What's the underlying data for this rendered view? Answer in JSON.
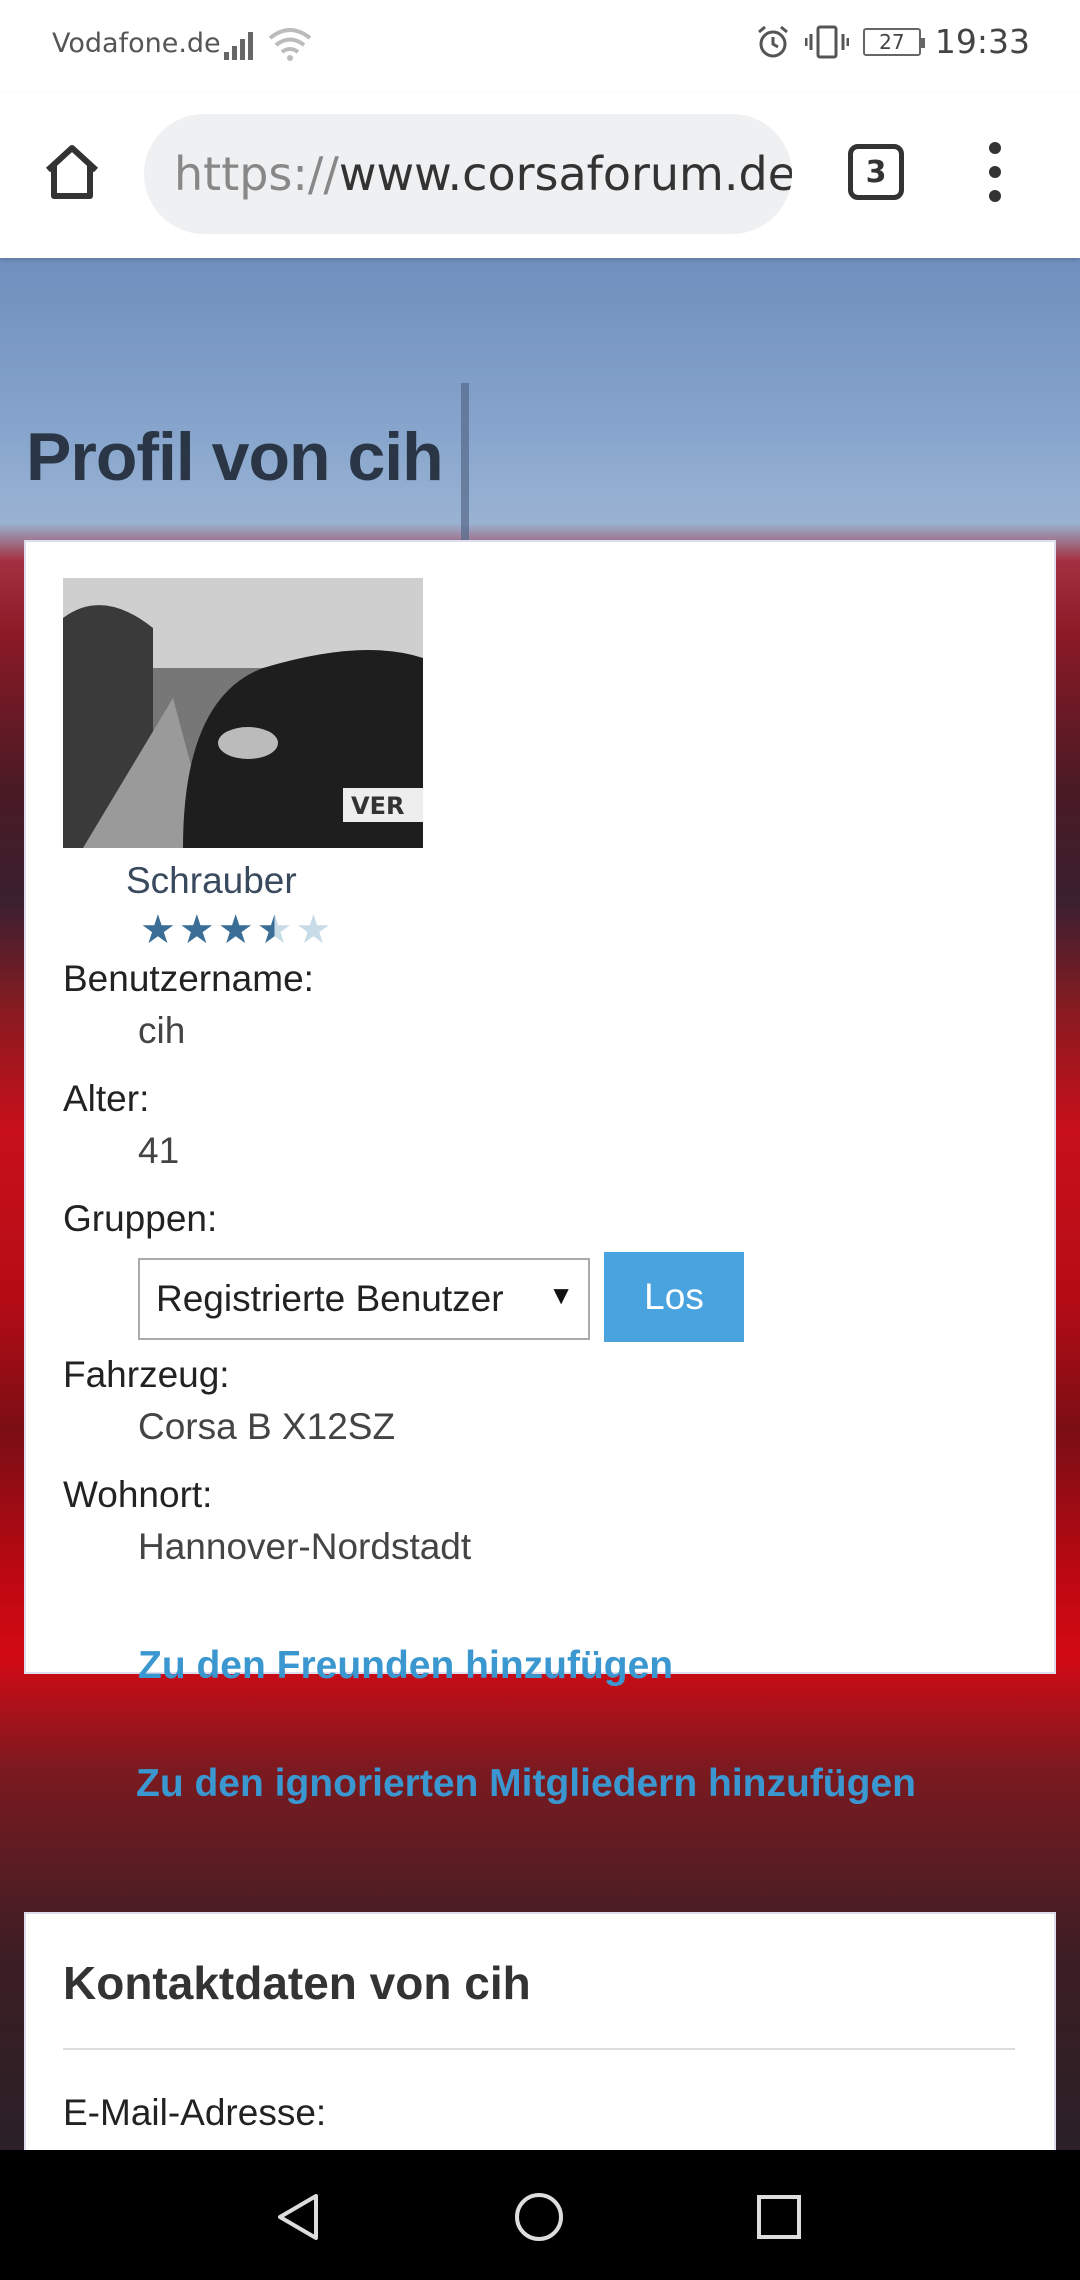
{
  "status_bar": {
    "carrier": "Vodafone.de",
    "battery": "27",
    "time": "19:33"
  },
  "browser": {
    "url_scheme": "https://",
    "url_host": "www.corsaforum.de",
    "tab_count": "3"
  },
  "page": {
    "title": "Profil von cih"
  },
  "profile": {
    "rank": "Schrauber",
    "rating_stars": 3.5,
    "rating_max": 5,
    "fields": {
      "username_label": "Benutzername:",
      "username_value": "cih",
      "age_label": "Alter:",
      "age_value": "41",
      "groups_label": "Gruppen:",
      "groups_selected": "Registrierte Benutzer",
      "go_button": "Los",
      "vehicle_label": "Fahrzeug:",
      "vehicle_value": "Corsa B X12SZ",
      "location_label": "Wohnort:",
      "location_value": "Hannover-Nordstadt"
    },
    "links": {
      "add_friend": "Zu den Freunden hinzufügen",
      "add_ignored": "Zu den ignorierten Mitgliedern hinzufügen"
    }
  },
  "contact": {
    "title": "Kontaktdaten von cih",
    "email_label": "E-Mail-Adresse:"
  },
  "icons": [
    "home-icon",
    "tabs-icon",
    "overflow-menu-icon",
    "back-icon",
    "home-circle-icon",
    "recents-icon",
    "alarm-icon",
    "vibrate-icon",
    "signal-icon",
    "wifi-icon",
    "battery-icon"
  ]
}
